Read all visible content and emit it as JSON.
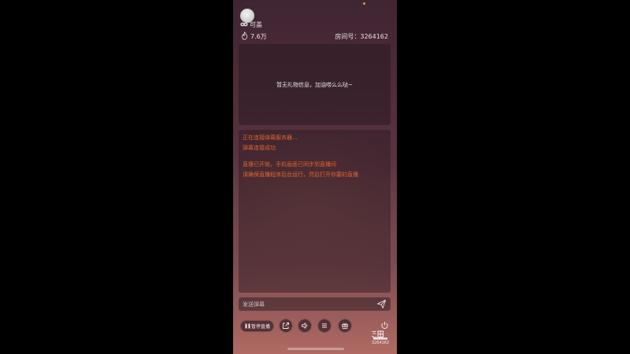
{
  "header": {
    "username": "可盖",
    "heat": "7.6万",
    "room_id_label": "房间号：3264162"
  },
  "gift_panel": {
    "empty_text": "暂无礼物信息，加油唠么么哒~"
  },
  "danmaku_panel": {
    "messages": [
      "正在连接弹幕服务器...",
      "弹幕连接成功",
      "直播已开始，手机画面已同步到直播间",
      "请确保直播程序后台运行，然后打开你要的直播"
    ]
  },
  "send_bar": {
    "placeholder": "发送弹幕"
  },
  "toolbar": {
    "pause_label": "暂停直播",
    "logo_room": "3264162"
  },
  "icons": {
    "avatar": "avatar-icon",
    "badge": "badge-icon",
    "heat": "flame-icon",
    "send": "send-icon",
    "share": "share-icon",
    "volume": "volume-icon",
    "menu": "menu-icon",
    "gift": "gift-icon",
    "power": "power-icon",
    "logo": "douyu-logo"
  },
  "colors": {
    "system_message": "#e0642c",
    "primary_text": "#e9e2e4"
  }
}
